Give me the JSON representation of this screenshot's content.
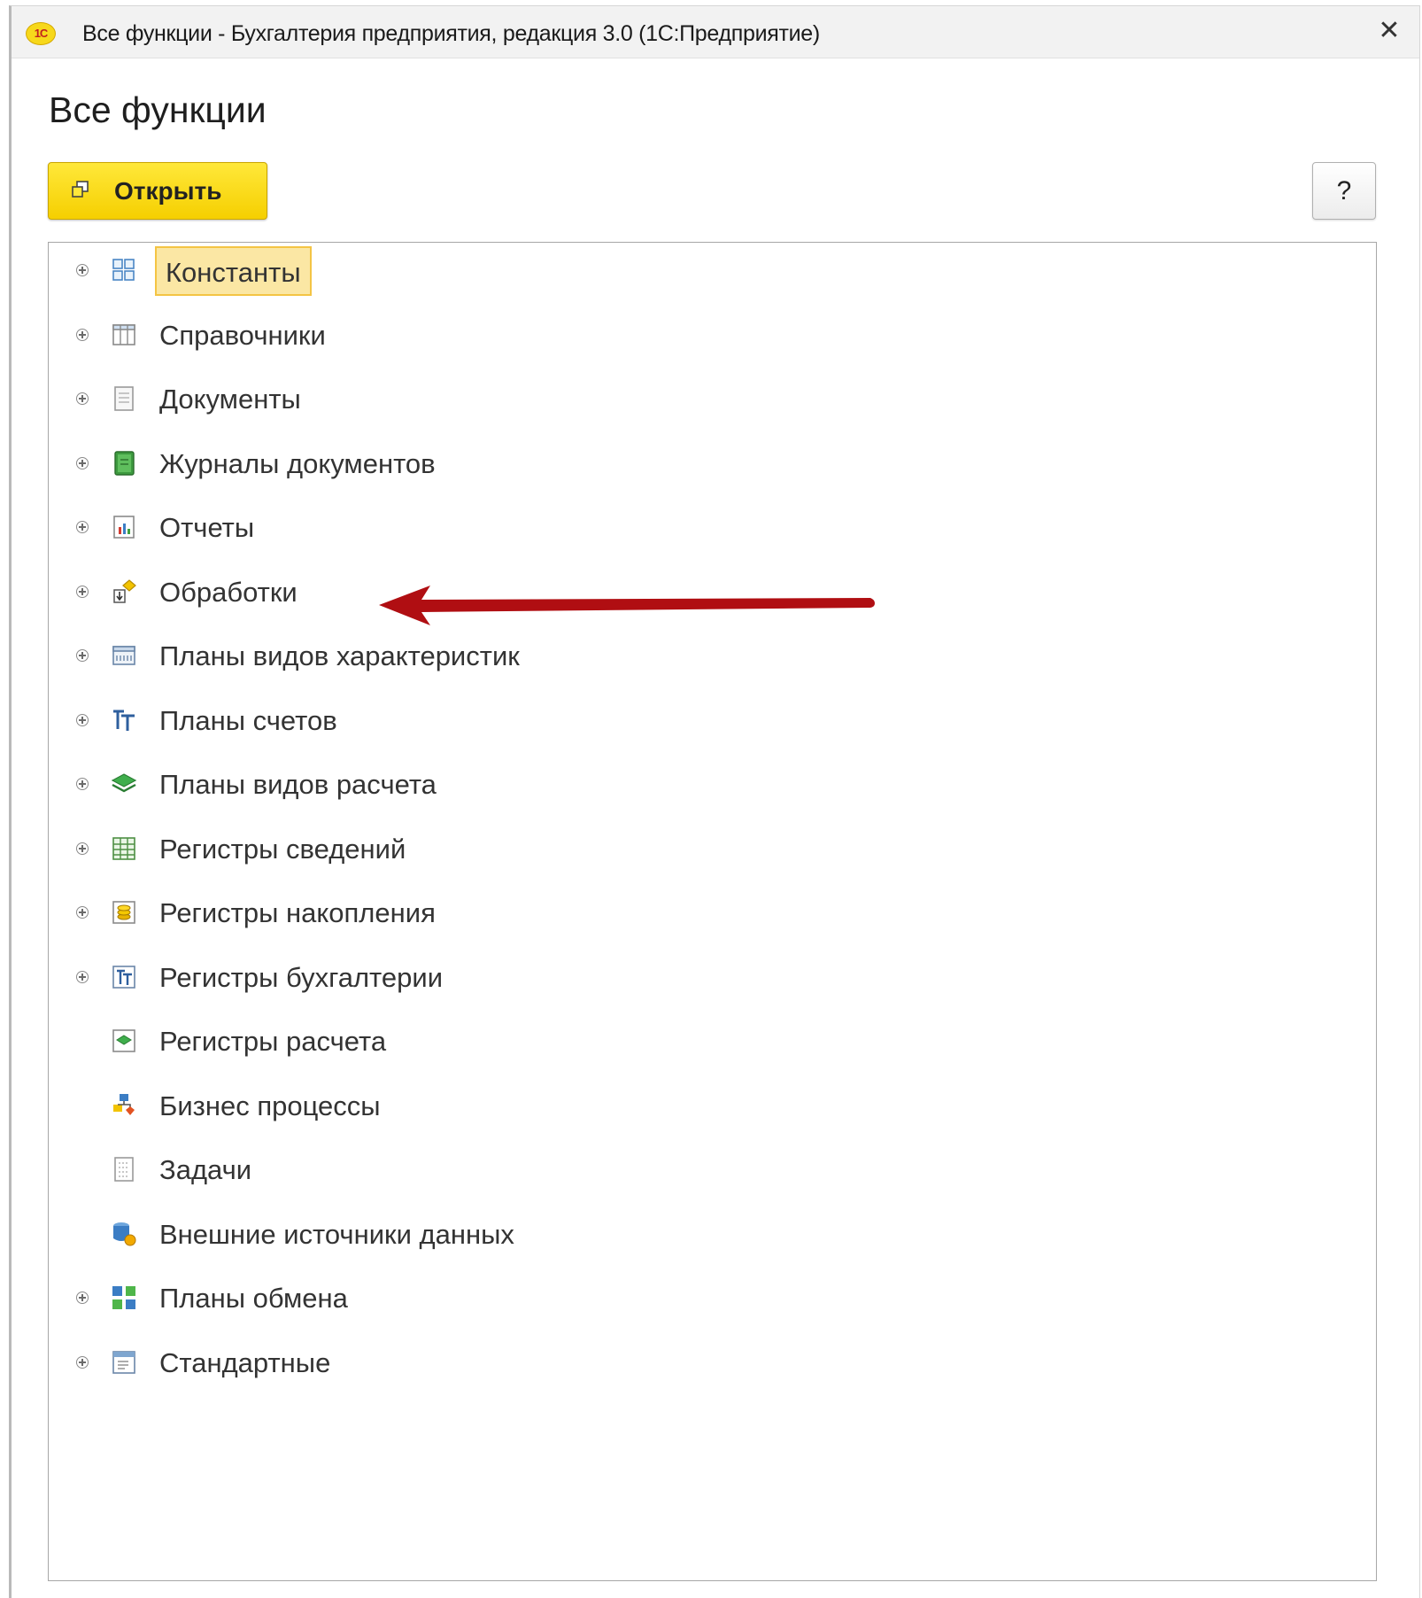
{
  "window": {
    "logo_text": "1С",
    "title": "Все функции - Бухгалтерия предприятия, редакция 3.0  (1С:Предприятие)",
    "close_symbol": "✕"
  },
  "page": {
    "title": "Все функции"
  },
  "toolbar": {
    "open_label": "Открыть",
    "help_label": "?"
  },
  "tree": {
    "items": [
      {
        "label": "Константы",
        "icon": "constants-icon",
        "expandable": true,
        "selected": true
      },
      {
        "label": "Справочники",
        "icon": "catalogs-icon",
        "expandable": true
      },
      {
        "label": "Документы",
        "icon": "documents-icon",
        "expandable": true
      },
      {
        "label": "Журналы документов",
        "icon": "document-journals-icon",
        "expandable": true
      },
      {
        "label": "Отчеты",
        "icon": "reports-icon",
        "expandable": true
      },
      {
        "label": "Обработки",
        "icon": "data-processors-icon",
        "expandable": true
      },
      {
        "label": "Планы видов характеристик",
        "icon": "characteristic-types-icon",
        "expandable": true
      },
      {
        "label": "Планы счетов",
        "icon": "charts-of-accounts-icon",
        "expandable": true
      },
      {
        "label": "Планы видов расчета",
        "icon": "calculation-types-icon",
        "expandable": true
      },
      {
        "label": "Регистры сведений",
        "icon": "information-registers-icon",
        "expandable": true
      },
      {
        "label": "Регистры накопления",
        "icon": "accumulation-registers-icon",
        "expandable": true
      },
      {
        "label": "Регистры бухгалтерии",
        "icon": "accounting-registers-icon",
        "expandable": true
      },
      {
        "label": "Регистры расчета",
        "icon": "calculation-registers-icon",
        "expandable": false
      },
      {
        "label": "Бизнес процессы",
        "icon": "business-processes-icon",
        "expandable": false
      },
      {
        "label": "Задачи",
        "icon": "tasks-icon",
        "expandable": false
      },
      {
        "label": "Внешние источники данных",
        "icon": "external-data-sources-icon",
        "expandable": false
      },
      {
        "label": "Планы обмена",
        "icon": "exchange-plans-icon",
        "expandable": true
      },
      {
        "label": "Стандартные",
        "icon": "standard-icon",
        "expandable": true
      }
    ]
  },
  "colors": {
    "selection_fill": "#fbe7a4",
    "selection_border": "#f4c444",
    "open_button": "#f5cf00",
    "annotation_arrow": "#b00e12"
  }
}
